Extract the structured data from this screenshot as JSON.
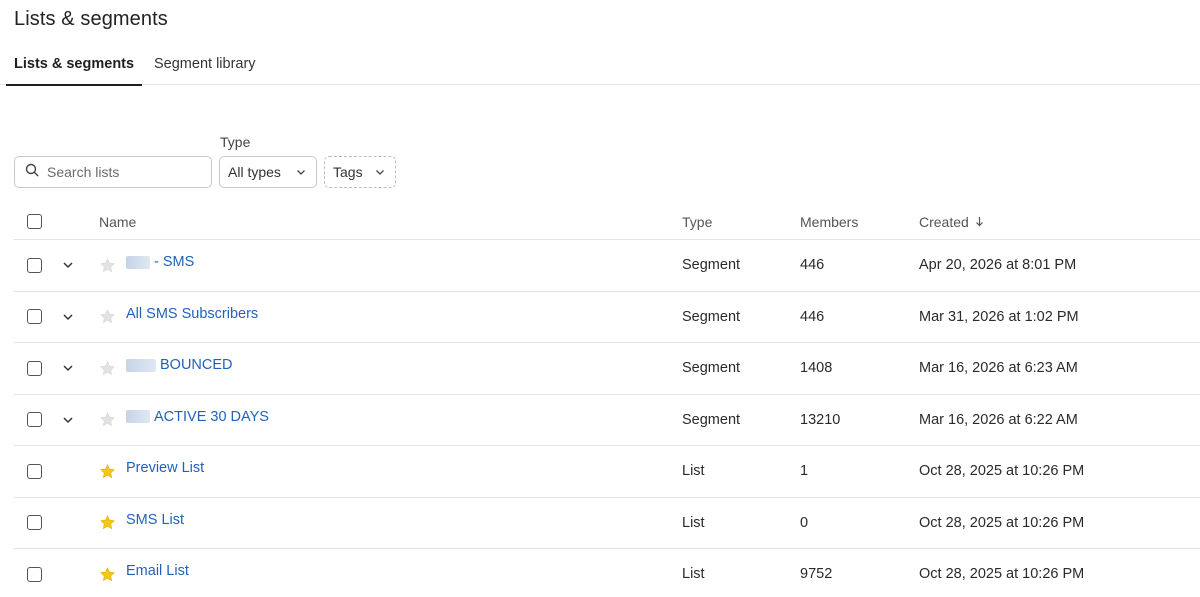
{
  "page": {
    "title": "Lists & segments"
  },
  "tabs": [
    {
      "label": "Lists & segments",
      "active": true
    },
    {
      "label": "Segment library",
      "active": false
    }
  ],
  "filters": {
    "search_placeholder": "Search lists",
    "type_label": "Type",
    "type_value": "All types",
    "tags_value": "Tags"
  },
  "table": {
    "columns": {
      "name": "Name",
      "type": "Type",
      "members": "Members",
      "created": "Created"
    },
    "rows": [
      {
        "name": "- SMS",
        "redacted": true,
        "starred": false,
        "expandable": true,
        "type": "Segment",
        "members": "446",
        "created": "Apr 20, 2026 at 8:01 PM"
      },
      {
        "name": "All SMS Subscribers",
        "redacted": false,
        "starred": false,
        "expandable": true,
        "type": "Segment",
        "members": "446",
        "created": "Mar 31, 2026 at 1:02 PM"
      },
      {
        "name": "BOUNCED",
        "redacted": true,
        "starred": false,
        "expandable": true,
        "type": "Segment",
        "members": "1408",
        "created": "Mar 16, 2026 at 6:23 AM"
      },
      {
        "name": "ACTIVE 30 DAYS",
        "redacted": true,
        "starred": false,
        "expandable": true,
        "type": "Segment",
        "members": "13210",
        "created": "Mar 16, 2026 at 6:22 AM"
      },
      {
        "name": "Preview List",
        "redacted": false,
        "starred": true,
        "expandable": false,
        "type": "List",
        "members": "1",
        "created": "Oct 28, 2025 at 10:26 PM"
      },
      {
        "name": "SMS List",
        "redacted": false,
        "starred": true,
        "expandable": false,
        "type": "List",
        "members": "0",
        "created": "Oct 28, 2025 at 10:26 PM"
      },
      {
        "name": "Email List",
        "redacted": false,
        "starred": true,
        "expandable": false,
        "type": "List",
        "members": "9752",
        "created": "Oct 28, 2025 at 10:26 PM"
      }
    ]
  },
  "colors": {
    "link": "#1f63b8",
    "star_on": "#f5c518",
    "star_off": "#e2e2e2",
    "divider": "#e3e3e3"
  },
  "icons": {
    "search": "search-icon",
    "chevron": "chevron-down-icon",
    "star": "star-icon",
    "sort": "arrow-down-icon"
  }
}
